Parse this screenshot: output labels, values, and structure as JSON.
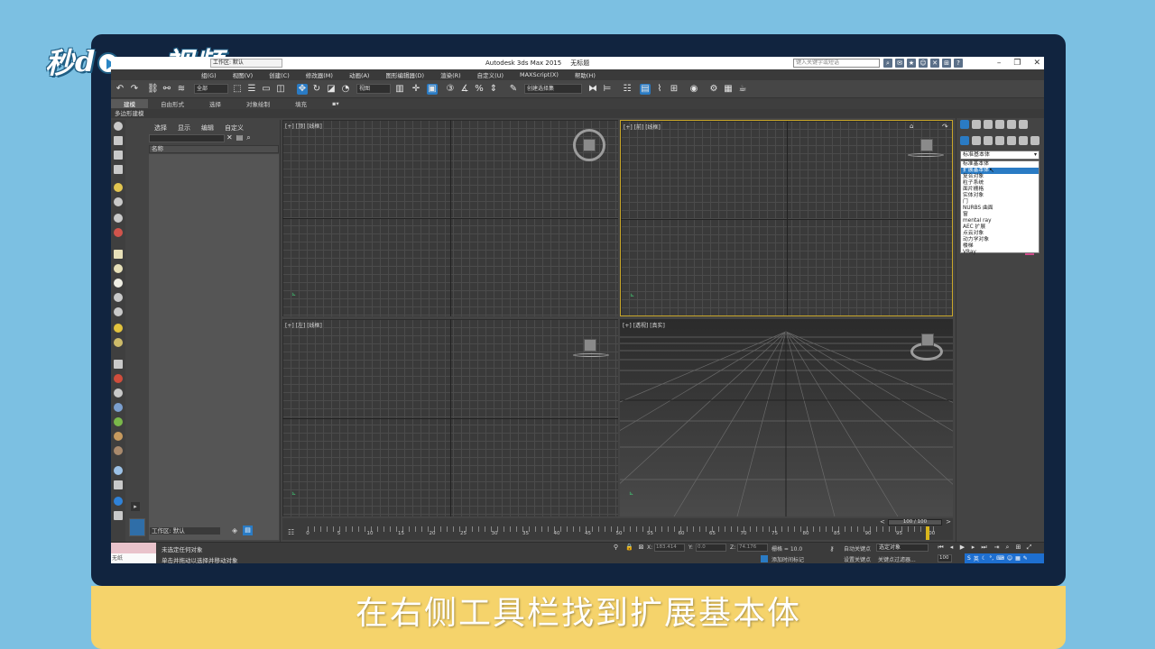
{
  "logo": {
    "part1": "秒",
    "part2": "d",
    "part3": "ng视频"
  },
  "caption": "在右侧工具栏找到扩展基本体",
  "app": {
    "workspace_combo": "工作区: 默认",
    "title_app": "Autodesk 3ds Max 2015",
    "title_doc": "无标题",
    "search_placeholder": "键入关键字或短语",
    "window_controls": {
      "minimize": "–",
      "restore": "❐",
      "close": "✕"
    },
    "help_icon": "?"
  },
  "menu": [
    "组(G)",
    "视图(V)",
    "创建(C)",
    "修改器(M)",
    "动画(A)",
    "图形编辑器(D)",
    "渲染(R)",
    "自定义(U)",
    "MAXScript(X)",
    "帮助(H)"
  ],
  "toolbar": {
    "filter_combo": "全部",
    "ref_coord_combo": "视图",
    "selection_set_combo": "创建选择集"
  },
  "ribbon": {
    "tabs": [
      "建模",
      "自由形式",
      "选择",
      "对象绘制",
      "填充"
    ],
    "active_tab": "建模",
    "sub_label": "多边形建模"
  },
  "scene_explorer": {
    "tabs": [
      "选择",
      "显示",
      "编辑",
      "自定义"
    ],
    "column_header": "名称"
  },
  "viewports": {
    "top": "[+] [顶] [线框]",
    "front": "[+] [前] [线框]",
    "left": "[+] [左] [线框]",
    "perspective": "[+] [透视] [真实]"
  },
  "command_panel": {
    "dropdown_value": "标准基本体",
    "dropdown_options": [
      "标准基本体",
      "扩展基本体",
      "复合对象",
      "粒子系统",
      "面片栅格",
      "实体对象",
      "门",
      "NURBS 曲面",
      "窗",
      "mental ray",
      "AEC 扩展",
      "点云对象",
      "动力学对象",
      "楼梯",
      "VRay"
    ],
    "selected_option": "扩展基本体"
  },
  "timeline": {
    "frame_readout": "100 / 100",
    "ruler_labels": [
      "0",
      "5",
      "10",
      "15",
      "20",
      "25",
      "30",
      "35",
      "40",
      "45",
      "50",
      "55",
      "60",
      "65",
      "70",
      "75",
      "80",
      "85",
      "90",
      "95",
      "100"
    ]
  },
  "workspace_bottom": "工作区: 默认",
  "status": {
    "maxscript_line": "无纸",
    "message_1": "未选定任何对象",
    "message_2": "单击并拖动以选择并移动对象",
    "x_label": "X:",
    "x_value": "183.414",
    "y_label": "Y:",
    "y_value": "0.0",
    "z_label": "Z:",
    "z_value": "74.176",
    "grid": "栅格 = 10.0",
    "autokey": "自动关键点",
    "set_key": "设置关键点",
    "selected_combo": "选定对象",
    "add_time_tag": "添加时间标记",
    "key_filters": "关键点过滤器...",
    "frame_field": "100"
  },
  "ime": {
    "lang": "英"
  }
}
